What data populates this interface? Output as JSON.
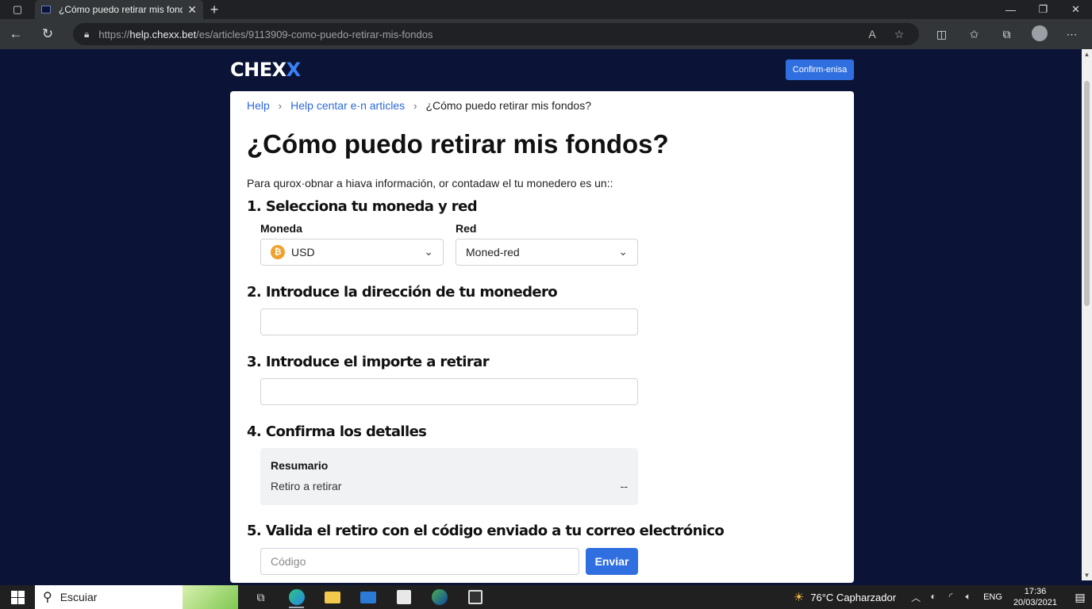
{
  "browser": {
    "tab_title": "¿Cómo puedo retirar mis fond",
    "url_prefix": "https://",
    "url_domain": "help.chexx.bet",
    "url_path": "/es/articles/9113909-como-puedo-retirar-mis-fondos"
  },
  "header": {
    "logo_main": "CHEX",
    "logo_accent": "X",
    "confirm_label": "Confirm-enisa"
  },
  "breadcrumb": {
    "home": "Help",
    "section": "Help centar e·n articles",
    "current": "¿Cómo puedo retirar mis fondos?"
  },
  "article": {
    "title": "¿Cómo puedo retirar mis fondos?",
    "intro": "Para qurox·obnar a hiava información, or contadaw el tu monedero es un::",
    "step1": "1. Selecciona tu moneda y red",
    "moneda_label": "Moneda",
    "moneda_value": "USD",
    "red_label": "Red",
    "red_value": "Moned-red",
    "step2": "2. Introduce la dirección de tu monedero",
    "address_value": "",
    "step3": "3. Introduce el importe a retirar",
    "amount_value": "",
    "step4": "4. Confirma los detalles",
    "summary_title": "Resumario",
    "summary_label": "Retiro a retirar",
    "summary_value": "--",
    "step5": "5. Valida el retiro con el código enviado a tu correo electrónico",
    "code_placeholder": "Código",
    "send_label": "Enviar"
  },
  "taskbar": {
    "search_text": "Escuiar",
    "weather": "76°C Capharzador",
    "language": "ENG",
    "time": "17:36",
    "date": "20/03/2021"
  }
}
